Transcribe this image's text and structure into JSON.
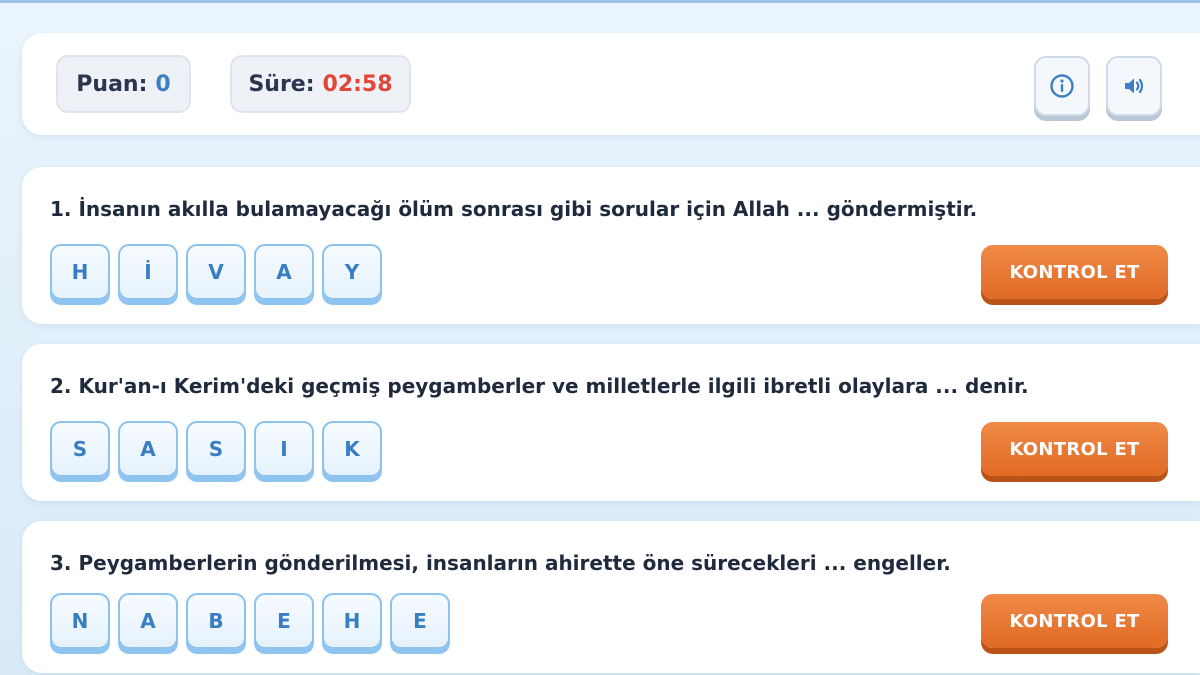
{
  "header": {
    "score_label": "Puan:",
    "score_value": "0",
    "time_label": "Süre:",
    "time_value": "02:58",
    "info_icon": "info-icon",
    "sound_icon": "speaker-icon"
  },
  "questions": [
    {
      "text": "1. İnsanın akılla bulamayacağı ölüm sonrası gibi sorular için Allah ... göndermiştir.",
      "letters": [
        "H",
        "İ",
        "V",
        "A",
        "Y"
      ],
      "button": "KONTROL ET"
    },
    {
      "text": "2. Kur'an-ı Kerim'deki geçmiş peygamberler ve milletlerle ilgili ibretli olaylara ... denir.",
      "letters": [
        "S",
        "A",
        "S",
        "I",
        "K"
      ],
      "button": "KONTROL ET"
    },
    {
      "text": "3. Peygamberlerin gönderilmesi, insanların ahirette öne sürecekleri ... engeller.",
      "letters": [
        "N",
        "A",
        "B",
        "E",
        "H",
        "E"
      ],
      "button": "KONTROL ET"
    }
  ],
  "colors": {
    "accent": "#3d7fc4",
    "timer": "#e0473a",
    "button": "#e8772f"
  }
}
